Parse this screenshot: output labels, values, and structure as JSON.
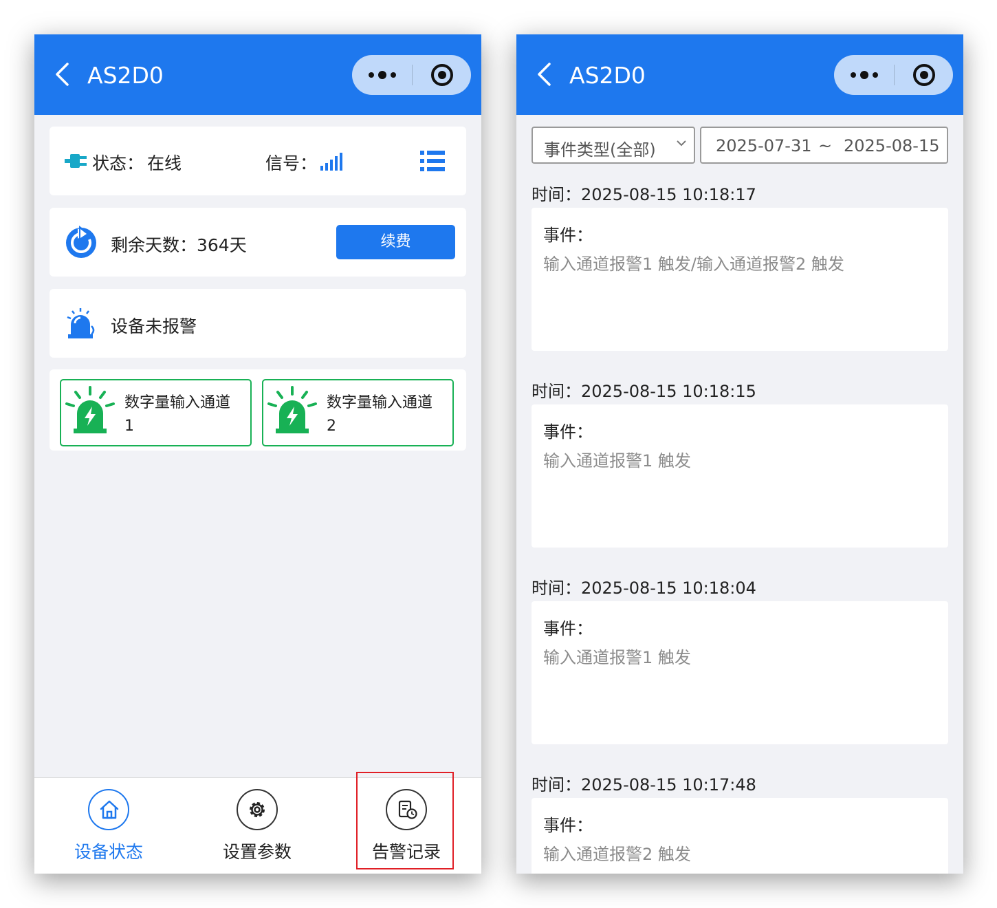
{
  "colors": {
    "primary": "#1e78ee",
    "online_green": "#18b155",
    "highlight_red": "#e01f26"
  },
  "left_screen": {
    "navbar": {
      "title": "AS2D0",
      "icons": [
        "back-chevron-icon",
        "more-dots-icon",
        "target-circle-icon"
      ]
    },
    "status_card": {
      "status_label": "状态：",
      "status_value": "在线",
      "signal_label": "信号："
    },
    "days_card": {
      "days_text": "剩余天数：364天",
      "renew_label": "续费"
    },
    "alarm_card": {
      "alarm_text": "设备未报警"
    },
    "channels": [
      {
        "line1": "数字量输入通道",
        "line2": "1"
      },
      {
        "line1": "数字量输入通道",
        "line2": "2"
      }
    ],
    "tabbar": [
      {
        "label": "设备状态",
        "icon": "home-icon",
        "active": true
      },
      {
        "label": "设置参数",
        "icon": "gear-icon",
        "active": false
      },
      {
        "label": "告警记录",
        "icon": "record-icon",
        "active": false
      }
    ]
  },
  "right_screen": {
    "navbar": {
      "title": "AS2D0"
    },
    "filter": {
      "event_type": "事件类型(全部)",
      "start_date": "2025-07-31",
      "separator": "~",
      "end_date": "2025-08-15"
    },
    "events": [
      {
        "time": "时间：2025-08-15 10:18:17",
        "label": "事件：",
        "desc": "输入通道报警1 触发/输入通道报警2 触发"
      },
      {
        "time": "时间：2025-08-15 10:18:15",
        "label": "事件：",
        "desc": "输入通道报警1 触发"
      },
      {
        "time": "时间：2025-08-15 10:18:04",
        "label": "事件：",
        "desc": "输入通道报警1 触发"
      },
      {
        "time": "时间：2025-08-15 10:17:48",
        "label": "事件：",
        "desc": "输入通道报警2 触发"
      }
    ]
  }
}
